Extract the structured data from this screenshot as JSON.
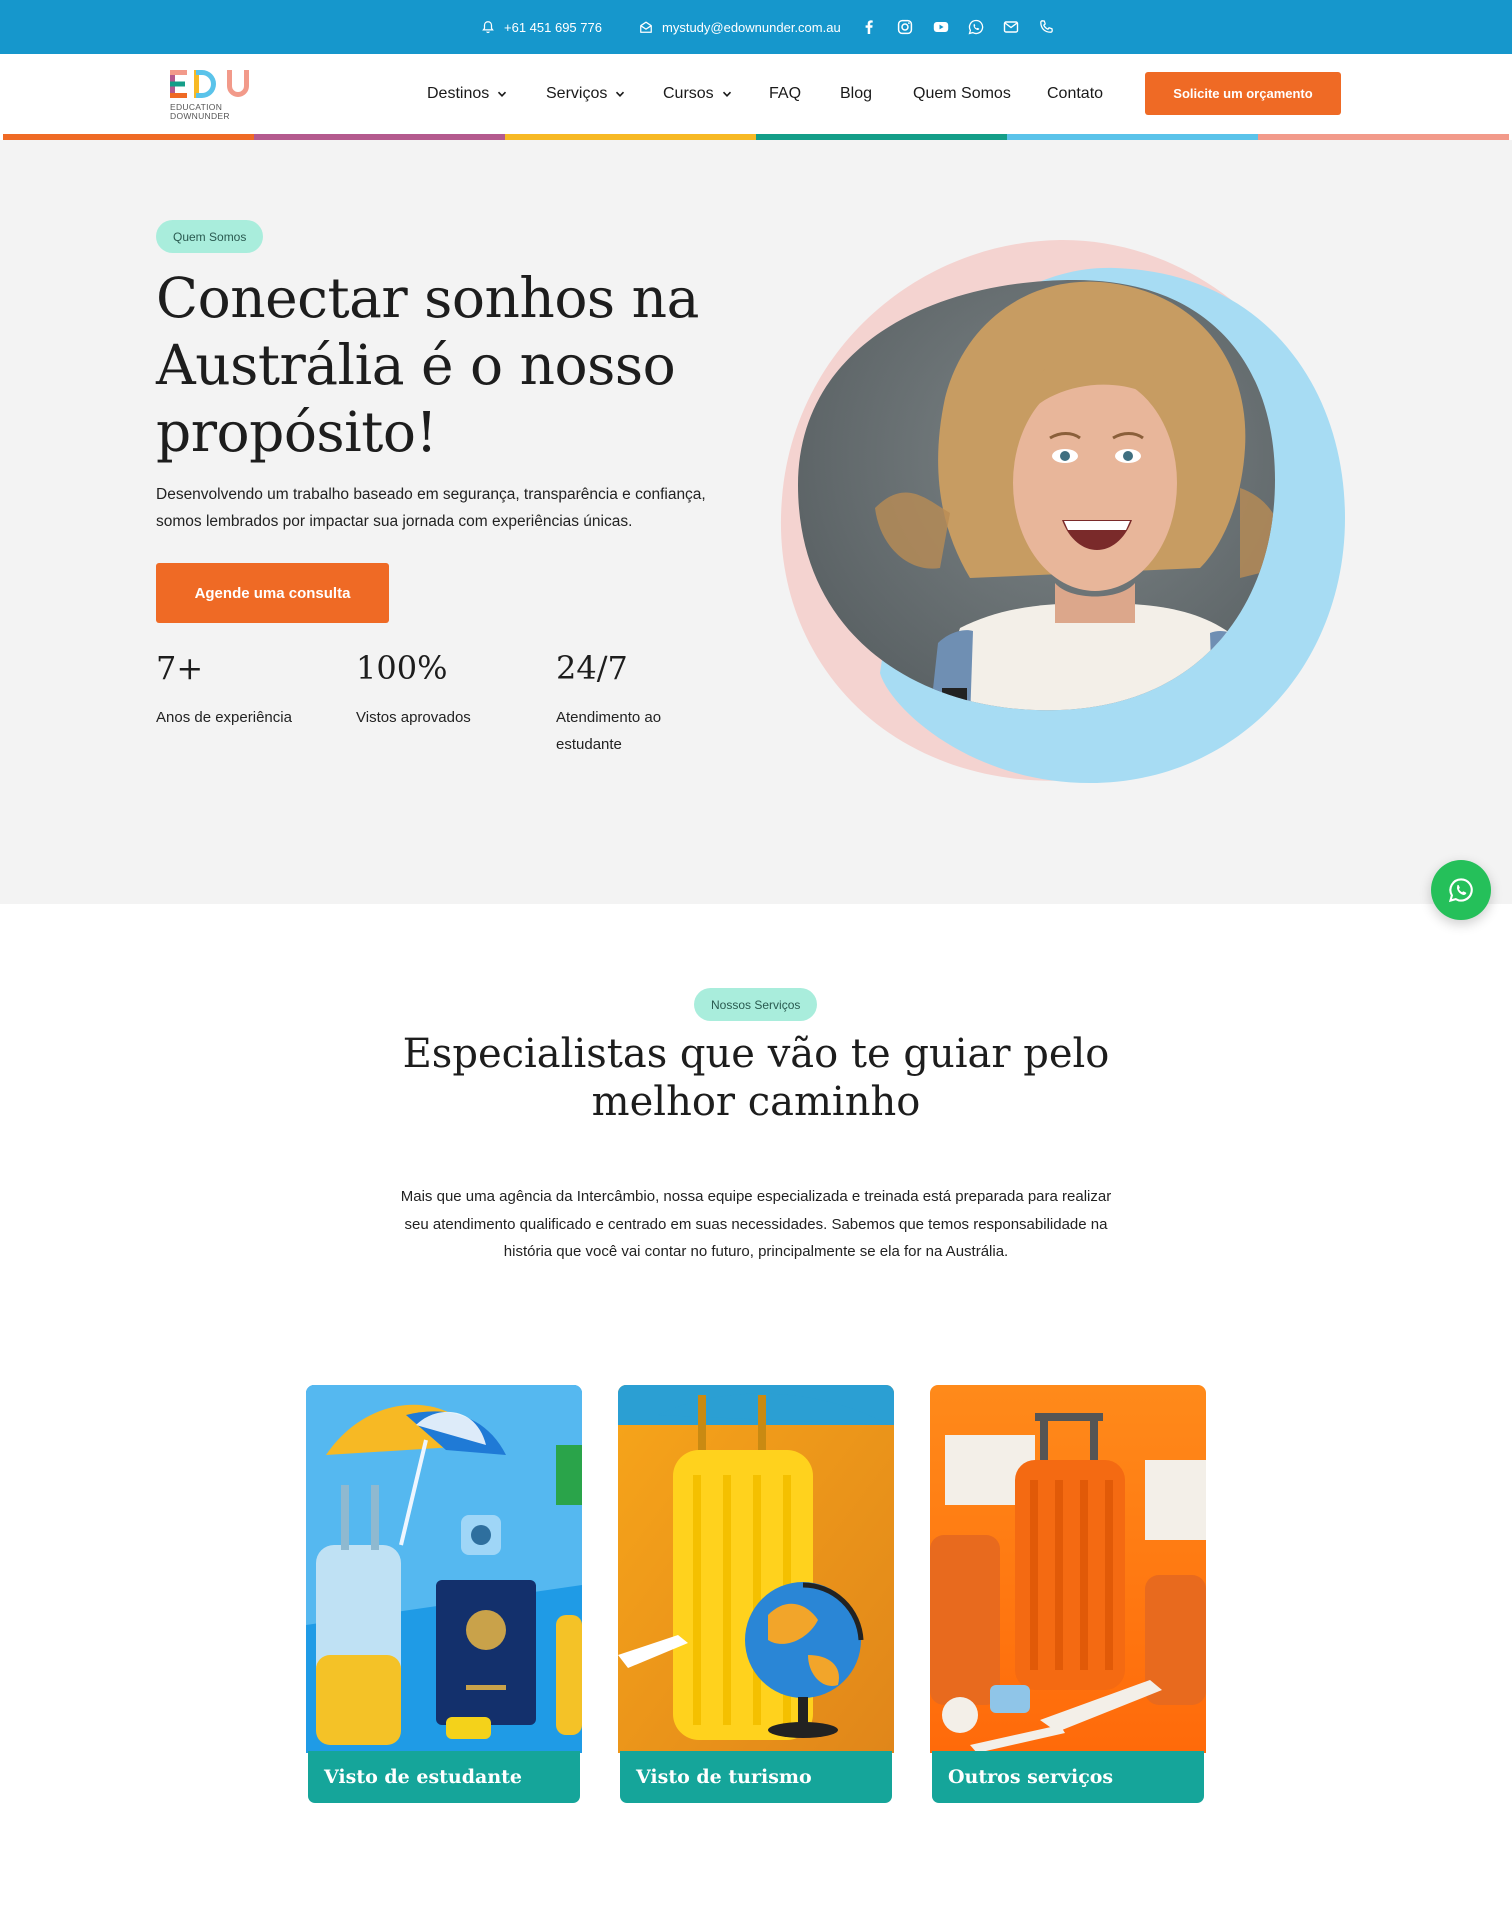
{
  "topbar": {
    "phone": "+61 451 695 776",
    "email": "mystudy@edownunder.com.au",
    "social_icons": [
      "facebook-icon",
      "instagram-icon",
      "youtube-icon",
      "whatsapp-icon",
      "mail-icon",
      "phone-icon"
    ]
  },
  "header": {
    "logo_text": "EDU",
    "logo_sub_1": "EDUCATION",
    "logo_sub_2": "DOWNUNDER",
    "nav": [
      {
        "label": "Destinos",
        "has_dropdown": true
      },
      {
        "label": "Serviços",
        "has_dropdown": true
      },
      {
        "label": "Cursos",
        "has_dropdown": true
      },
      {
        "label": "FAQ",
        "has_dropdown": false
      },
      {
        "label": "Blog",
        "has_dropdown": false
      },
      {
        "label": "Quem Somos",
        "has_dropdown": false
      },
      {
        "label": "Contato",
        "has_dropdown": false
      }
    ],
    "quote_button": "Solicite um orçamento"
  },
  "stripe_colors": [
    "#ef6a25",
    "#b45a8e",
    "#f7b924",
    "#149e88",
    "#5ac3ea",
    "#f29a8a"
  ],
  "hero": {
    "badge": "Quem Somos",
    "title": "Conectar sonhos na Austrália é o nosso propósito!",
    "description": "Desenvolvendo um trabalho baseado em segurança, transparência e confiança, somos lembrados por impactar sua jornada com experiências únicas.",
    "cta": "Agende uma consulta",
    "stats": [
      {
        "value": "7+",
        "label": "Anos de experiência"
      },
      {
        "value": "100%",
        "label": "Vistos aprovados"
      },
      {
        "value": "24/7",
        "label": "Atendimento ao estudante"
      }
    ]
  },
  "services": {
    "badge": "Nossos Serviços",
    "title": "Especialistas que vão te guiar pelo melhor caminho",
    "description": "Mais que uma agência da Intercâmbio, nossa equipe especializada e treinada está preparada para realizar seu atendimento qualificado e centrado em suas necessidades. Sabemos que temos responsabilidade na história que você vai contar no futuro, principalmente se ela for na Austrália.",
    "cards": [
      {
        "label": "Visto de estudante"
      },
      {
        "label": "Visto de turismo"
      },
      {
        "label": "Outros serviços"
      }
    ]
  },
  "colors": {
    "topbar": "#1697cc",
    "accent_orange": "#ef6a25",
    "teal": "#15a59a",
    "pill_bg": "#a9eddc",
    "whatsapp": "#25c05a"
  }
}
